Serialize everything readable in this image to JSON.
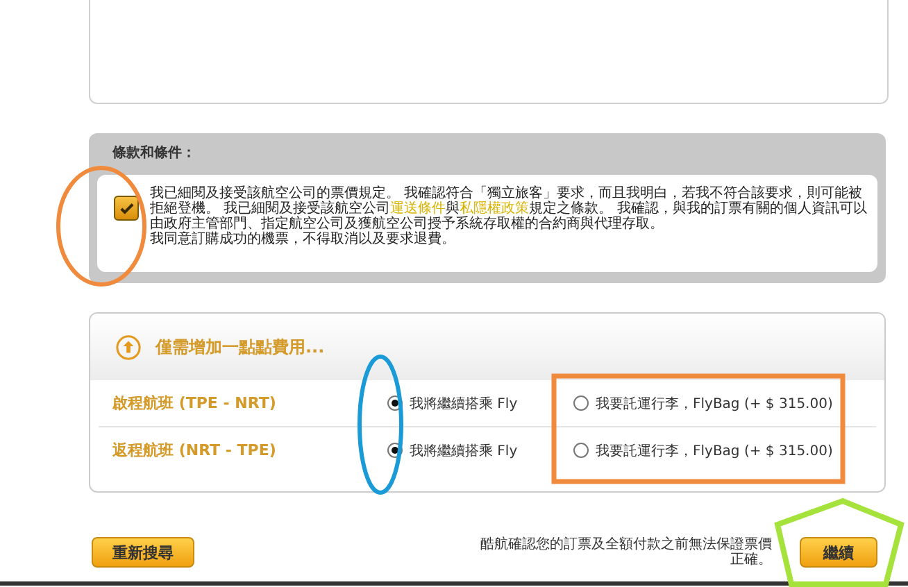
{
  "terms": {
    "title": "條款和條件：",
    "checked": true,
    "paragraph": [
      {
        "kind": "text",
        "text": "我已細閱及接受該航空公司的票價規定。 我確認符合「獨立旅客」要求，而且我明白，若我不符合該要求，則可能被拒絕登機。 我已細閱及接受該航空公司"
      },
      {
        "kind": "link",
        "text": "運送條件"
      },
      {
        "kind": "text",
        "text": "與"
      },
      {
        "kind": "link",
        "text": "私隱權政策"
      },
      {
        "kind": "text",
        "text": "規定之條款。 我確認，與我的訂票有關的個人資訊可以由政府主管部門、指定航空公司及獲航空公司授予系統存取權的合約商與代理存取。"
      }
    ],
    "agreement": "我同意訂購成功的機票，不得取消以及要求退費。"
  },
  "upgrade": {
    "title": "僅需增加一點點費用...",
    "rows": [
      {
        "flight": "啟程航班 (TPE - NRT)",
        "options": [
          {
            "label": "我將繼續搭乘 Fly",
            "selected": true
          },
          {
            "label": "我要託運行李，FlyBag (+ $ 315.00)",
            "selected": false
          }
        ]
      },
      {
        "flight": "返程航班 (NRT - TPE)",
        "options": [
          {
            "label": "我將繼續搭乘 Fly",
            "selected": true
          },
          {
            "label": "我要託運行李，FlyBag (+ $ 315.00)",
            "selected": false
          }
        ]
      }
    ]
  },
  "footer": {
    "search_again": "重新搜尋",
    "notice": "酷航確認您的訂票及全額付款之前無法保證票價正確。",
    "continue": "繼續"
  },
  "annotations": [
    {
      "kind": "circle",
      "color": "#f08a3c"
    },
    {
      "kind": "ellipse",
      "color": "#1a9ad6"
    },
    {
      "kind": "rect",
      "color": "#f08a3c"
    },
    {
      "kind": "pentagon",
      "color": "#a6e23c"
    }
  ]
}
